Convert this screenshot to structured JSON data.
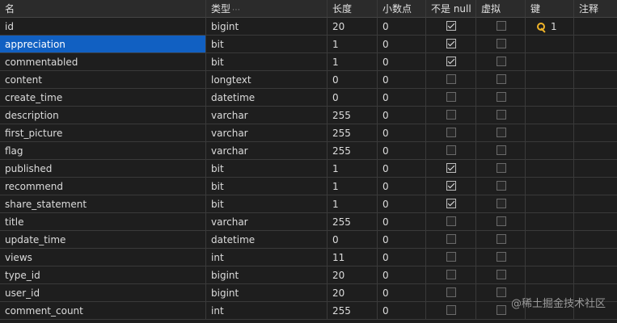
{
  "columns": [
    "名",
    "类型",
    "长度",
    "小数点",
    "不是 null",
    "虚拟",
    "键",
    "注释"
  ],
  "rows": [
    {
      "name": "id",
      "type": "bigint",
      "length": "20",
      "decimal": "0",
      "not_null": true,
      "virtual": false,
      "key": "1"
    },
    {
      "name": "appreciation",
      "type": "bit",
      "length": "1",
      "decimal": "0",
      "not_null": true,
      "virtual": false,
      "key": ""
    },
    {
      "name": "commentabled",
      "type": "bit",
      "length": "1",
      "decimal": "0",
      "not_null": true,
      "virtual": false,
      "key": ""
    },
    {
      "name": "content",
      "type": "longtext",
      "length": "0",
      "decimal": "0",
      "not_null": false,
      "virtual": false,
      "key": ""
    },
    {
      "name": "create_time",
      "type": "datetime",
      "length": "0",
      "decimal": "0",
      "not_null": false,
      "virtual": false,
      "key": ""
    },
    {
      "name": "description",
      "type": "varchar",
      "length": "255",
      "decimal": "0",
      "not_null": false,
      "virtual": false,
      "key": ""
    },
    {
      "name": "first_picture",
      "type": "varchar",
      "length": "255",
      "decimal": "0",
      "not_null": false,
      "virtual": false,
      "key": ""
    },
    {
      "name": "flag",
      "type": "varchar",
      "length": "255",
      "decimal": "0",
      "not_null": false,
      "virtual": false,
      "key": ""
    },
    {
      "name": "published",
      "type": "bit",
      "length": "1",
      "decimal": "0",
      "not_null": true,
      "virtual": false,
      "key": ""
    },
    {
      "name": "recommend",
      "type": "bit",
      "length": "1",
      "decimal": "0",
      "not_null": true,
      "virtual": false,
      "key": ""
    },
    {
      "name": "share_statement",
      "type": "bit",
      "length": "1",
      "decimal": "0",
      "not_null": true,
      "virtual": false,
      "key": ""
    },
    {
      "name": "title",
      "type": "varchar",
      "length": "255",
      "decimal": "0",
      "not_null": false,
      "virtual": false,
      "key": ""
    },
    {
      "name": "update_time",
      "type": "datetime",
      "length": "0",
      "decimal": "0",
      "not_null": false,
      "virtual": false,
      "key": ""
    },
    {
      "name": "views",
      "type": "int",
      "length": "11",
      "decimal": "0",
      "not_null": false,
      "virtual": false,
      "key": ""
    },
    {
      "name": "type_id",
      "type": "bigint",
      "length": "20",
      "decimal": "0",
      "not_null": false,
      "virtual": false,
      "key": ""
    },
    {
      "name": "user_id",
      "type": "bigint",
      "length": "20",
      "decimal": "0",
      "not_null": false,
      "virtual": false,
      "key": ""
    },
    {
      "name": "comment_count",
      "type": "int",
      "length": "255",
      "decimal": "0",
      "not_null": false,
      "virtual": false,
      "key": ""
    }
  ],
  "selected_row": 1,
  "watermark": "@稀土掘金技术社区",
  "colors": {
    "background": "#1e1e1e",
    "header": "#2b2b2b",
    "selection": "#1160c2",
    "key": "#f0b429"
  }
}
